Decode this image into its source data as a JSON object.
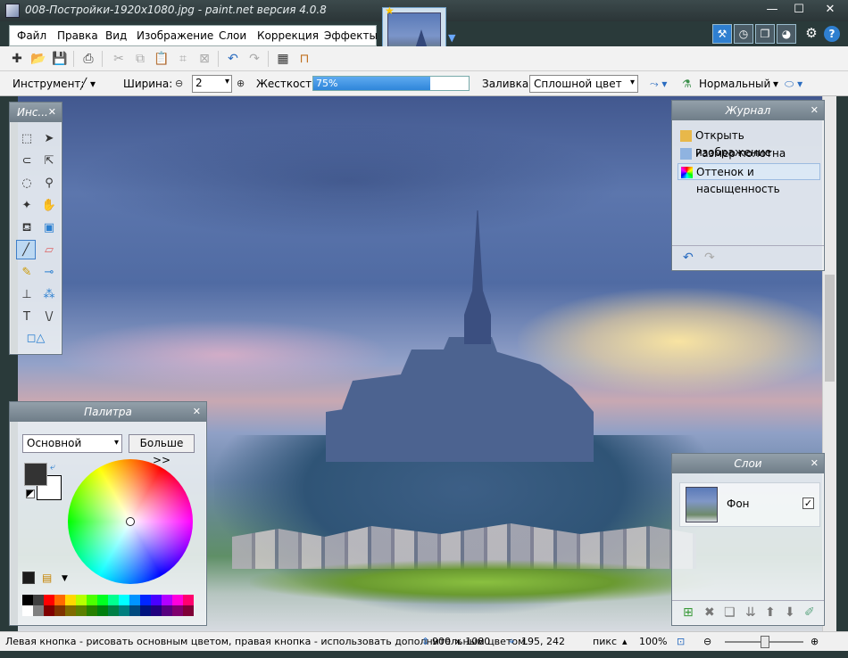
{
  "window": {
    "title": "008-Постройки-1920x1080.jpg - paint.net версия 4.0.8",
    "minimize": "—",
    "maximize": "☐",
    "close": "✕"
  },
  "menu": {
    "items": [
      "Файл",
      "Правка",
      "Вид",
      "Изображение",
      "Слои",
      "Коррекция",
      "Эффекты"
    ]
  },
  "toolbar": {
    "tool_label": "Инструмент:",
    "width_label": "Ширина:",
    "width_value": "2",
    "hardness_label": "Жесткость:",
    "hardness_value": "75%",
    "hardness_fraction": 0.75,
    "fill_label": "Заливка:",
    "fill_value": "Сплошной цвет",
    "blend_value": "Нормальный"
  },
  "tools_panel": {
    "title": "Инс..."
  },
  "history_panel": {
    "title": "Журнал",
    "items": [
      "Открыть изображение",
      "Размер полотна",
      "Оттенок и насыщенность"
    ],
    "selected_index": 2
  },
  "palette_panel": {
    "title": "Палитра",
    "mode_select": "Основной",
    "more_button": "Больше >>",
    "primary_color": "#333333",
    "secondary_color": "#ffffff",
    "swatches_top": [
      "#000000",
      "#404040",
      "#ff0000",
      "#ff6a00",
      "#ffd800",
      "#b6ff00",
      "#4cff00",
      "#00ff21",
      "#00ff90",
      "#00ffff",
      "#0094ff",
      "#0026ff",
      "#4800ff",
      "#b200ff",
      "#ff00dc",
      "#ff006e"
    ],
    "swatches_bottom": [
      "#ffffff",
      "#808080",
      "#7f0000",
      "#7f3300",
      "#7f6a00",
      "#5b7f00",
      "#267f00",
      "#007f0e",
      "#007f46",
      "#007f7f",
      "#004a7f",
      "#00137f",
      "#21007f",
      "#57007f",
      "#7f006e",
      "#7f0037"
    ]
  },
  "layers_panel": {
    "title": "Слои",
    "layers": [
      {
        "name": "Фон",
        "visible_mark": "✓"
      }
    ]
  },
  "status": {
    "hint": "Левая кнопка - рисовать основным цветом, правая кнопка - использовать дополнительным цветом.",
    "image_size": "900 × 1080",
    "cursor_pos": "195, 242",
    "units": "пикс",
    "zoom": "100%"
  },
  "icons": {
    "tools": [
      "rectangle-select-icon",
      "move-selection-icon",
      "lasso-select-icon",
      "move-selected-icon",
      "ellipse-select-icon",
      "zoom-icon",
      "magic-wand-icon",
      "pan-icon",
      "paint-bucket-icon",
      "gradient-icon",
      "paintbrush-icon",
      "eraser-icon",
      "pencil-icon",
      "color-picker-icon",
      "clone-stamp-icon",
      "recolor-icon",
      "text-icon",
      "line-curve-icon",
      "shapes-icon"
    ]
  }
}
